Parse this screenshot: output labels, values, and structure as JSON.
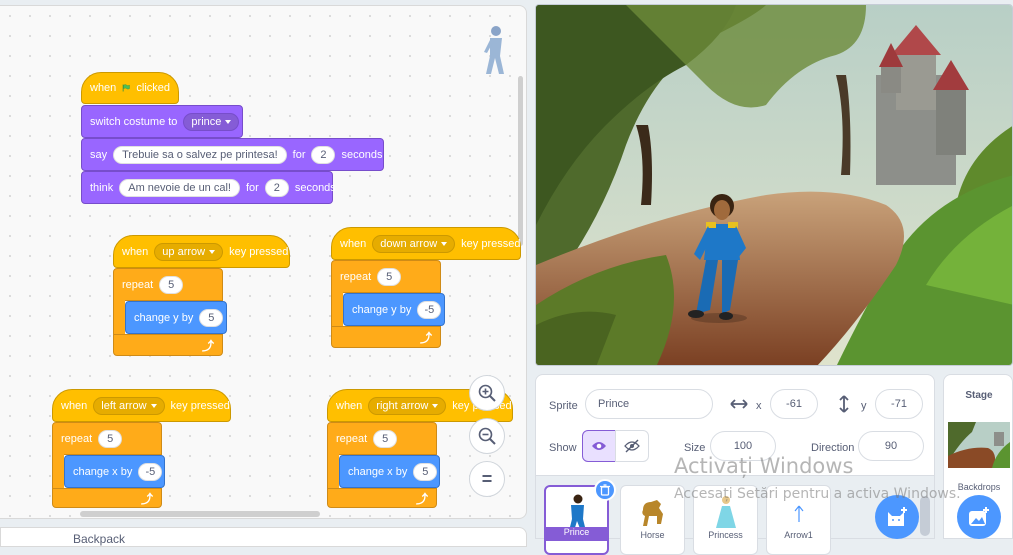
{
  "code_area": {
    "script1": {
      "hat_when": "when",
      "hat_clicked": "clicked",
      "switch_label": "switch costume to",
      "costume_value": "prince",
      "say_label": "say",
      "say_text": "Trebuie sa o salvez pe printesa!",
      "say_for": "for",
      "say_secs": "2",
      "say_seconds": "seconds",
      "think_label": "think",
      "think_text": "Am nevoie de un cal!",
      "think_for": "for",
      "think_secs": "2",
      "think_seconds": "seconds"
    },
    "script_up": {
      "when": "when",
      "key": "up arrow",
      "pressed": "key pressed",
      "repeat": "repeat",
      "times": "5",
      "change": "change y by",
      "amount": "5"
    },
    "script_down": {
      "when": "when",
      "key": "down arrow",
      "pressed": "key pressed",
      "repeat": "repeat",
      "times": "5",
      "change": "change y by",
      "amount": "-5"
    },
    "script_left": {
      "when": "when",
      "key": "left arrow",
      "pressed": "key pressed",
      "repeat": "repeat",
      "times": "5",
      "change": "change x by",
      "amount": "-5"
    },
    "script_right": {
      "when": "when",
      "key": "right arrow",
      "pressed": "key pressed",
      "repeat": "repeat",
      "times": "5",
      "change": "change x by",
      "amount": "5"
    },
    "zoom_in": "+",
    "zoom_out": "−",
    "zoom_reset": "="
  },
  "backpack": {
    "label": "Backpack"
  },
  "sprite_info": {
    "sprite_label": "Sprite",
    "sprite_name": "Prince",
    "x_label": "x",
    "x_value": "-61",
    "y_label": "y",
    "y_value": "-71",
    "show_label": "Show",
    "size_label": "Size",
    "size_value": "100",
    "direction_label": "Direction",
    "direction_value": "90"
  },
  "sprites": [
    {
      "name": "Prince",
      "selected": true
    },
    {
      "name": "Horse",
      "selected": false
    },
    {
      "name": "Princess",
      "selected": false
    },
    {
      "name": "Arrow1",
      "selected": false
    }
  ],
  "stage_panel": {
    "title": "Stage",
    "backdrops_label": "Backdrops"
  },
  "watermark": {
    "line1": "Activați Windows",
    "line2": "Accesați Setări pentru a activa Windows."
  },
  "colors": {
    "events": "#ffbf00",
    "control": "#ffab19",
    "looks": "#9966ff",
    "motion": "#4c97ff",
    "accent": "#855cd6"
  }
}
